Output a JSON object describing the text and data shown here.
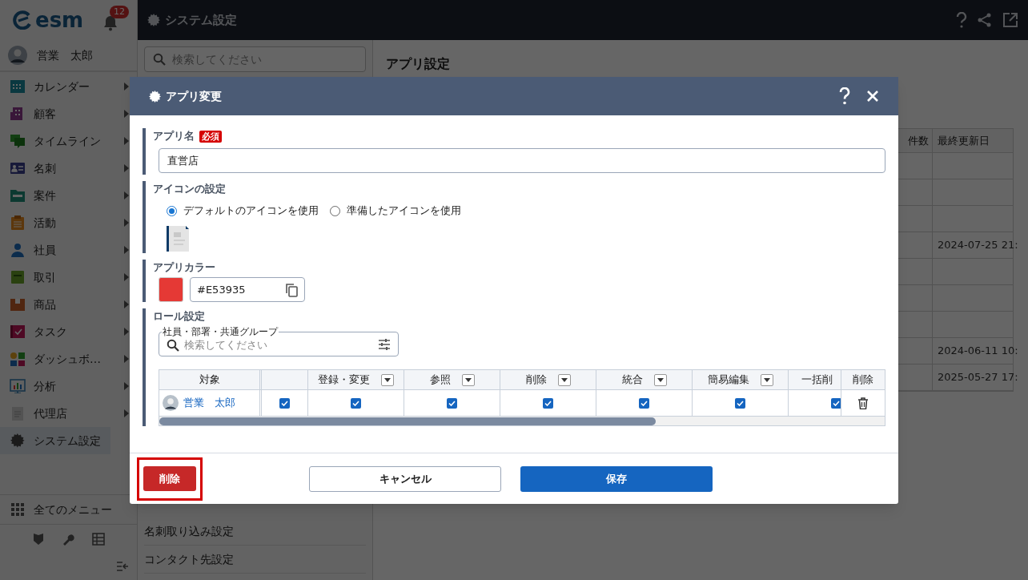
{
  "app": {
    "logo": "esm",
    "notifications": "12",
    "user": "営業　太郎"
  },
  "sidebar": {
    "items": [
      {
        "label": "カレンダー",
        "kind": "calendar",
        "has_submenu": true,
        "selected": false
      },
      {
        "label": "顧客",
        "kind": "building",
        "has_submenu": true,
        "selected": false
      },
      {
        "label": "タイムライン",
        "kind": "chat",
        "has_submenu": true,
        "selected": false
      },
      {
        "label": "名刺",
        "kind": "card",
        "has_submenu": true,
        "selected": false
      },
      {
        "label": "案件",
        "kind": "folder",
        "has_submenu": true,
        "selected": false
      },
      {
        "label": "活動",
        "kind": "clipboard",
        "has_submenu": true,
        "selected": false
      },
      {
        "label": "社員",
        "kind": "person",
        "has_submenu": true,
        "selected": false
      },
      {
        "label": "取引",
        "kind": "notebook",
        "has_submenu": true,
        "selected": false
      },
      {
        "label": "商品",
        "kind": "box",
        "has_submenu": true,
        "selected": false
      },
      {
        "label": "タスク",
        "kind": "task",
        "has_submenu": true,
        "selected": false
      },
      {
        "label": "ダッシュボ…",
        "kind": "dashboard",
        "has_submenu": true,
        "selected": false
      },
      {
        "label": "分析",
        "kind": "chart",
        "has_submenu": true,
        "selected": false
      },
      {
        "label": "代理店",
        "kind": "document",
        "has_submenu": true,
        "selected": false
      },
      {
        "label": "システム設定",
        "kind": "gear",
        "has_submenu": false,
        "selected": true
      }
    ],
    "all_menu": "全てのメニュー"
  },
  "header": {
    "title": "システム設定"
  },
  "settings_list": {
    "search_placeholder": "検索してください",
    "items": [
      "名刺取り込み設定",
      "コンタクト先設定"
    ]
  },
  "content": {
    "title": "アプリ設定",
    "table": {
      "columns": [
        "件数",
        "最終更新日"
      ],
      "rows": [
        {},
        {},
        {},
        {
          "last_updated": "2024-07-25 21:"
        },
        {},
        {},
        {},
        {
          "last_updated": "2024-06-11 10:"
        },
        {
          "last_updated": "2025-05-27 17:"
        }
      ]
    }
  },
  "dialog": {
    "title": "アプリ変更",
    "app_name": {
      "label": "アプリ名",
      "required_badge": "必須",
      "value": "直営店"
    },
    "icon_setting": {
      "label": "アイコンの設定",
      "options": [
        {
          "label": "デフォルトのアイコンを使用",
          "selected": true
        },
        {
          "label": "準備したアイコンを使用",
          "selected": false
        }
      ]
    },
    "app_color": {
      "label": "アプリカラー",
      "color": "#e53935",
      "value": "#E53935"
    },
    "roles": {
      "label": "ロール設定",
      "search_label": "社員・部署・共通グループ",
      "search_placeholder": "検索してください",
      "columns": [
        {
          "label": "対象",
          "dropdown": false
        },
        {
          "dropdown": false
        },
        {
          "label": "登録・変更",
          "dropdown": true
        },
        {
          "label": "参照",
          "dropdown": true
        },
        {
          "label": "削除",
          "dropdown": true
        },
        {
          "label": "統合",
          "dropdown": true
        },
        {
          "label": "簡易編集",
          "dropdown": true
        },
        {
          "label": "一括削",
          "dropdown": false
        }
      ],
      "action_column": "削除",
      "rows": [
        {
          "name": "営業　太郎",
          "checks": [
            {
              "checked": true
            },
            {
              "checked": true
            },
            {
              "checked": true
            },
            {
              "checked": true
            },
            {
              "checked": true
            },
            {
              "checked": true
            },
            {
              "checked": true
            }
          ]
        }
      ]
    },
    "buttons": {
      "delete": "削除",
      "cancel": "キャンセル",
      "save": "保存"
    }
  }
}
